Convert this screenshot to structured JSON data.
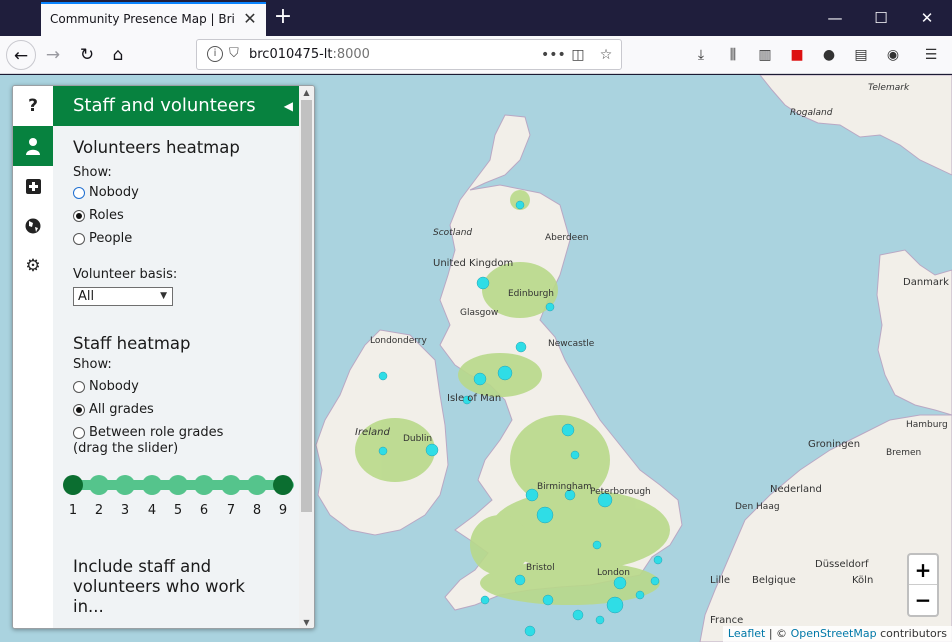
{
  "browser": {
    "tab_title": "Community Presence Map | British",
    "url_host": "brc010475-lt",
    "url_port": ":8000"
  },
  "sidebar": {
    "header": "Staff and volunteers",
    "tabs": [
      "help-icon",
      "person-icon",
      "plus-square-icon",
      "globe-icon",
      "gear-icon"
    ],
    "volunteers_heading": "Volunteers heatmap",
    "show_label": "Show:",
    "volunteer_options": [
      "Nobody",
      "Roles",
      "People"
    ],
    "volunteer_selected": "Roles",
    "basis_label": "Volunteer basis:",
    "basis_value": "All",
    "staff_heading": "Staff heatmap",
    "staff_show_label": "Show:",
    "staff_options": [
      "Nobody",
      "All grades",
      "Between role grades"
    ],
    "staff_selected": "All grades",
    "staff_drag_hint": "(drag the slider)",
    "grade_ticks": [
      "1",
      "2",
      "3",
      "4",
      "5",
      "6",
      "7",
      "8",
      "9"
    ],
    "include_heading": "Include staff and volunteers who work in..."
  },
  "map": {
    "labels": {
      "telemark": "Telemark",
      "rogaland": "Rogaland",
      "scotland": "Scotland",
      "aberdeen": "Aberdeen",
      "united_kingdom": "United Kingdom",
      "edinburgh": "Edinburgh",
      "glasgow": "Glasgow",
      "isle_of_man": "Isle of Man",
      "ireland": "Ireland",
      "dublin": "Dublin",
      "londonderry": "Londonderry",
      "newcastle": "Newcastle",
      "birmingham": "Birmingham",
      "peterborough": "Peterborough",
      "london": "London",
      "bristol": "Bristol",
      "danmark": "Danmark",
      "nederland": "Nederland",
      "den_haag": "Den Haag",
      "groningen": "Groningen",
      "bremen": "Bremen",
      "hamburg": "Hamburg",
      "lille": "Lille",
      "belgique": "Belgique",
      "dusseldorf": "Düsseldorf",
      "koln": "Köln",
      "france": "France"
    },
    "zoom_in": "+",
    "zoom_out": "−",
    "attribution_leaflet": "Leaflet",
    "attribution_osm": "OpenStreetMap",
    "attribution_suffix": " contributors",
    "heat_color": "#2fdde6",
    "land_color": "#f2efe9",
    "sea_color": "#aad3df"
  }
}
